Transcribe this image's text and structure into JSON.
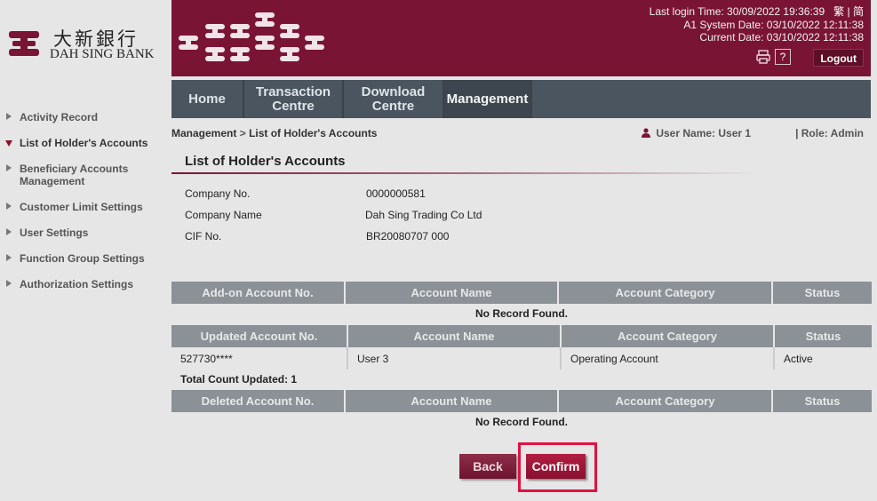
{
  "brand": {
    "cn": "大新銀行",
    "en": "DAH SING BANK"
  },
  "header": {
    "last_login": "Last login Time: 30/09/2022 19:36:39",
    "lang_trad": "繁",
    "lang_sep": "|",
    "lang_simp": "简",
    "system_date": "A1 System Date: 03/10/2022 12:11:38",
    "current_date": "Current Date: 03/10/2022 12:11:38",
    "help_label": "?",
    "logout_label": "Logout"
  },
  "nav": {
    "tabs": [
      {
        "line1": "Home",
        "line2": ""
      },
      {
        "line1": "Transaction",
        "line2": "Centre"
      },
      {
        "line1": "Download",
        "line2": "Centre"
      },
      {
        "line1": "Management",
        "line2": ""
      }
    ],
    "active_index": 3
  },
  "sidebar": {
    "items": [
      {
        "label": "Activity Record",
        "active": false
      },
      {
        "label": "List of Holder's Accounts",
        "active": true
      },
      {
        "label": "Beneficiary Accounts Management",
        "active": false
      },
      {
        "label": "Customer Limit Settings",
        "active": false
      },
      {
        "label": "User Settings",
        "active": false
      },
      {
        "label": "Function Group Settings",
        "active": false
      },
      {
        "label": "Authorization Settings",
        "active": false
      }
    ]
  },
  "breadcrumb": {
    "root": "Management",
    "sep": ">",
    "current": "List of Holder's Accounts"
  },
  "user": {
    "name": "User Name: User 1",
    "role": "| Role: Admin"
  },
  "page_title": "List of Holder's Accounts",
  "company": {
    "no_label": "Company No.",
    "no_value": "0000000581",
    "name_label": "Company Name",
    "name_value": "Dah Sing Trading Co Ltd",
    "cif_label": "CIF No.",
    "cif_value": "BR20080707 000"
  },
  "added_table": {
    "headers": [
      "Add-on Account No.",
      "Account Name",
      "Account Category",
      "Status"
    ],
    "empty": "No Record Found."
  },
  "updated_table": {
    "headers": [
      "Updated Account No.",
      "Account Name",
      "Account Category",
      "Status"
    ],
    "rows": [
      {
        "account_no": "527730****",
        "account_name": "User 3",
        "category": "Operating Account",
        "status": "Active"
      }
    ],
    "total": "Total Count Updated:  1"
  },
  "deleted_table": {
    "headers": [
      "Deleted Account No.",
      "Account Name",
      "Account Category",
      "Status"
    ],
    "empty": "No Record Found."
  },
  "buttons": {
    "back": "Back",
    "confirm": "Confirm"
  },
  "colors": {
    "brand": "#7a1435",
    "nav": "#4a5560",
    "header_cell": "#8b9196",
    "highlight": "#e0123f"
  }
}
